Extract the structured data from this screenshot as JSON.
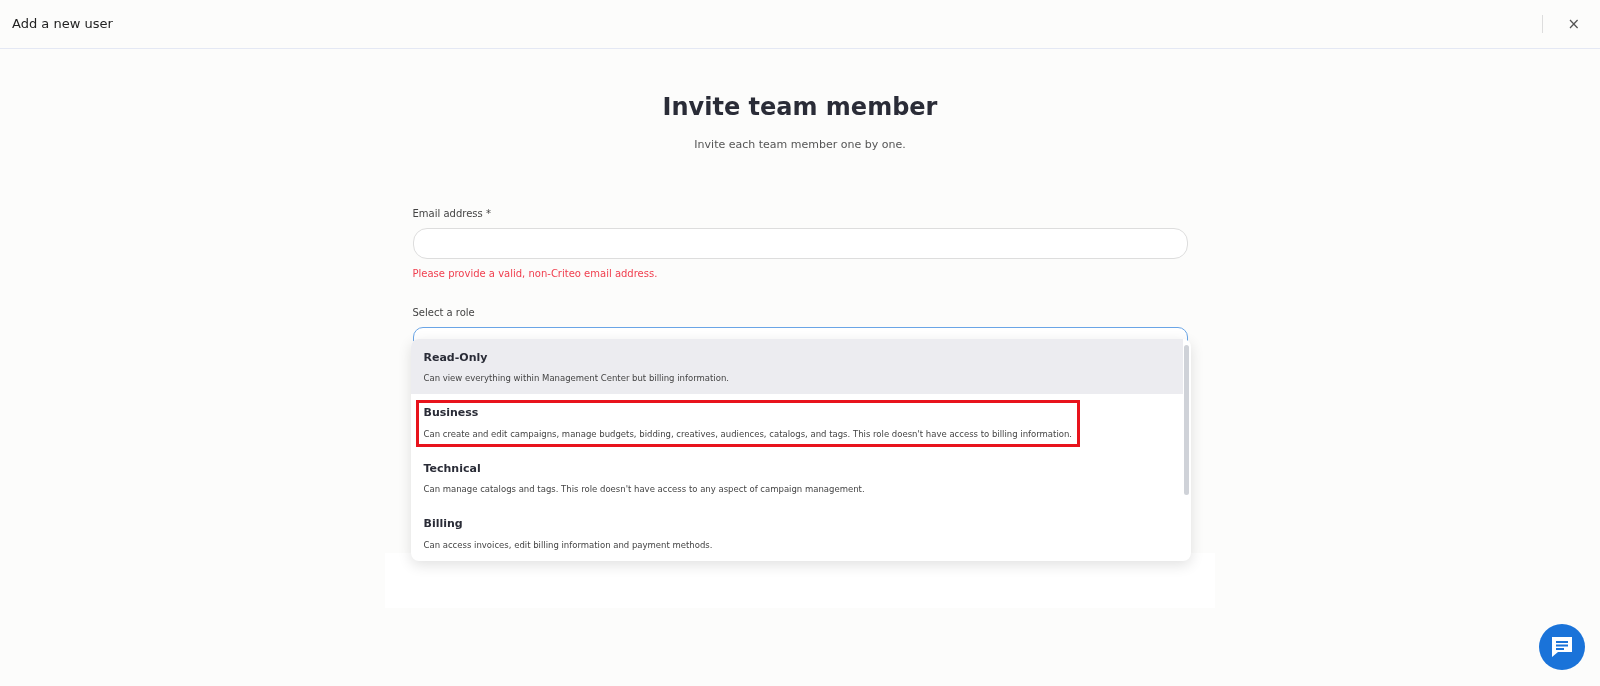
{
  "header": {
    "title": "Add a new user",
    "close": "×"
  },
  "heading": "Invite team member",
  "subtitle": "Invite each team member one by one.",
  "email": {
    "label": "Email address *",
    "error": "Please provide a valid, non-Criteo email address."
  },
  "role": {
    "label": "Select a role",
    "expanded": true,
    "options": [
      {
        "name": "Read-Only",
        "description": "Can view everything within Management Center but billing information.",
        "hovered": true,
        "outlined": false
      },
      {
        "name": "Business",
        "description": "Can create and edit campaigns, manage budgets, bidding, creatives, audiences, catalogs, and tags. This role doesn't have access to billing information.",
        "hovered": false,
        "outlined": true
      },
      {
        "name": "Technical",
        "description": "Can manage catalogs and tags. This role doesn't have access to any aspect of campaign management.",
        "hovered": false,
        "outlined": false
      },
      {
        "name": "Billing",
        "description": "Can access invoices, edit billing information and payment methods.",
        "hovered": false,
        "outlined": false
      }
    ]
  }
}
